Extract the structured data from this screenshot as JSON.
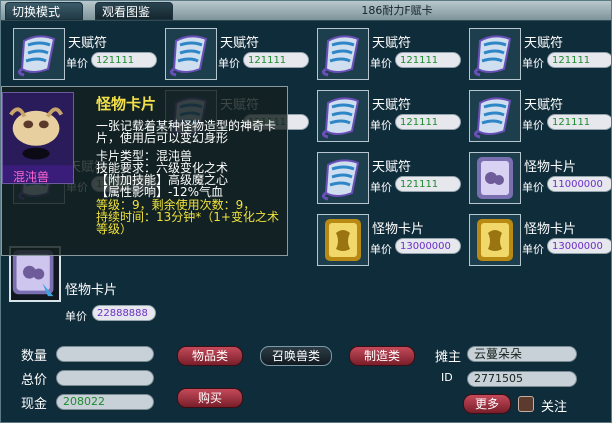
{
  "tabs": {
    "switch_mode": "切换模式",
    "view_gallery": "观看图鉴"
  },
  "title": "186耐力F赋卡",
  "price_label": "单价",
  "grid": [
    {
      "name": "天赋符",
      "price": "121111",
      "kind": "scroll"
    },
    {
      "name": "天赋符",
      "price": "121111",
      "kind": "scroll"
    },
    {
      "name": "天赋符",
      "price": "121111",
      "kind": "scroll"
    },
    {
      "name": "天赋符",
      "price": "121111",
      "kind": "scroll"
    },
    {
      "name": "天赋符",
      "price": "121111",
      "kind": "scroll"
    },
    {
      "name": "天赋符",
      "price": "121111",
      "kind": "scroll"
    },
    {
      "name": "天赋符",
      "price": "121111",
      "kind": "scroll"
    },
    {
      "name": "天赋符",
      "price": "121111",
      "kind": "scroll"
    },
    {
      "name": "天赋符",
      "price": "121111",
      "kind": "scroll"
    },
    {
      "name": "怪物卡片",
      "price": "11000000",
      "kind": "card"
    },
    {
      "name": "怪物卡片",
      "price": "13000000",
      "kind": "gold"
    },
    {
      "name": "怪物卡片",
      "price": "13000000",
      "kind": "gold"
    }
  ],
  "selected": {
    "name": "怪物卡片",
    "price": "22888888"
  },
  "tooltip": {
    "title": "怪物卡片",
    "portrait_label": "混沌兽",
    "desc": "一张记载着某种怪物造型的神奇卡片，使用后可以变幻身形",
    "card_type": "卡片类型：混沌兽",
    "skill_req": "技能要求：六级变化之术",
    "attached": "【附加技能】高级魔之心",
    "attr": "【属性影响】-12%气血",
    "level_line": "等级：9，剩余使用次数：9，",
    "duration": "持续时间：13分钟*（1+变化之术等级）"
  },
  "bottom": {
    "qty_label": "数量",
    "total_label": "总价",
    "cash_label": "现金",
    "cash_value": "208022",
    "btn_items": "物品类",
    "btn_summon": "召唤兽类",
    "btn_craft": "制造类",
    "btn_buy": "购买",
    "owner_label": "摊主",
    "owner_value": "云蔓朵朵",
    "id_label": "ID",
    "id_value": "2771505",
    "btn_more": "更多",
    "follow_label": "关注"
  },
  "colors": {
    "green_price": "#1f8a2f",
    "purple_price": "#6b2fc6",
    "tooltip_yellow": "#f0e23c"
  }
}
